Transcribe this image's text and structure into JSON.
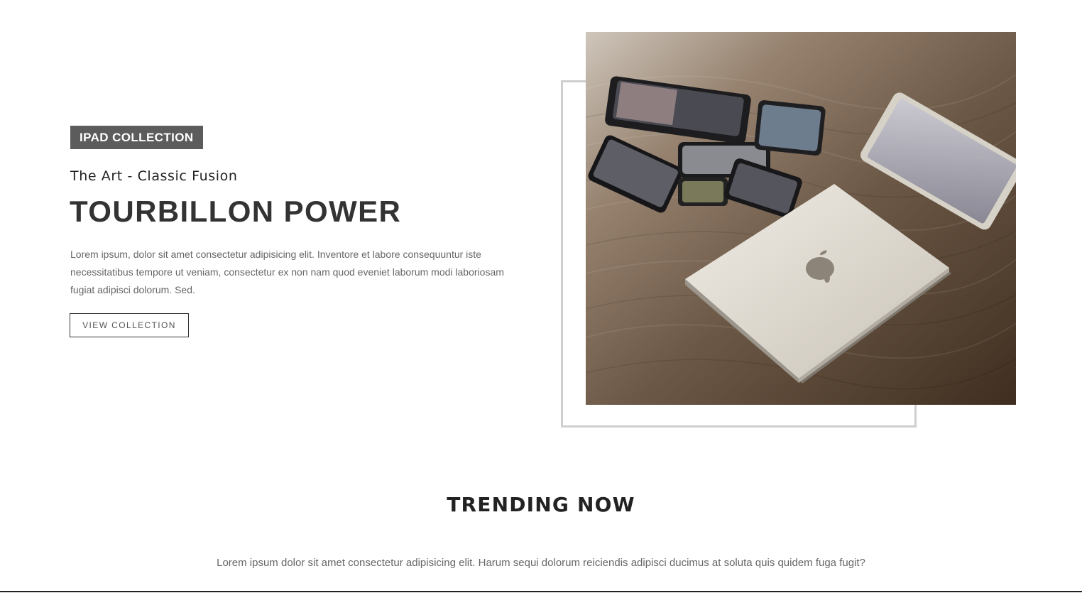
{
  "hero": {
    "badge": "IPAD COLLECTION",
    "subtitle": "The Art - Classic Fusion",
    "headline": "TOURBILLON POWER",
    "description": "Lorem ipsum, dolor sit amet consectetur adipisicing elit. Inventore et labore consequuntur iste necessitatibus tempore ut veniam, consectetur ex non nam quod eveniet laborum modi laboriosam fugiat adipisci dolorum. Sed.",
    "button_label": "VIEW COLLECTION",
    "image_subject": "laptop-and-devices-photo"
  },
  "trending": {
    "title": "TRENDING NOW",
    "text": "Lorem ipsum dolor sit amet consectetur adipisicing elit. Harum sequi dolorum reiciendis adipisci ducimus at soluta quis quidem fuga fugit?"
  },
  "colors": {
    "badge_bg": "#5c5c5c",
    "frame_border": "#cfcfcf",
    "heading_text": "#333333",
    "body_text": "#666666"
  }
}
